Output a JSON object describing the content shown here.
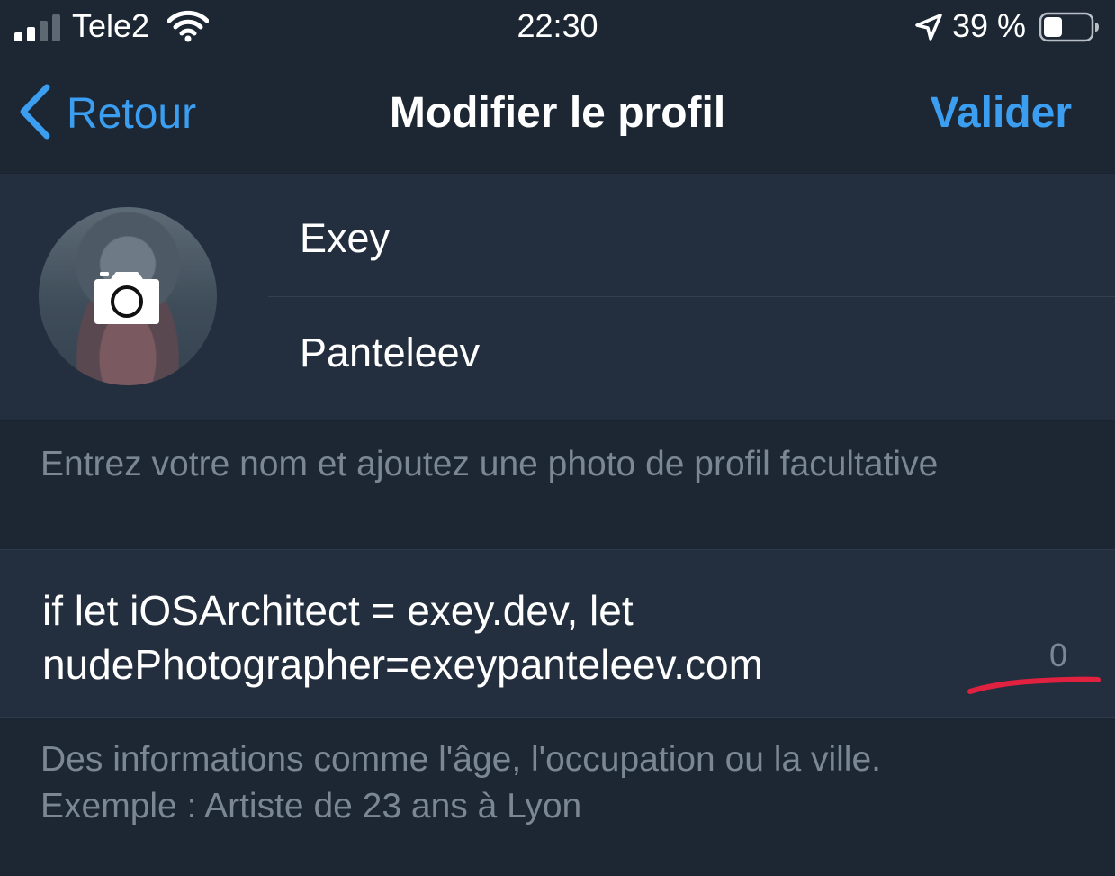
{
  "status_bar": {
    "carrier": "Tele2",
    "time": "22:30",
    "battery": "39 %",
    "battery_level": 0.39,
    "signal_bars_active": 2,
    "signal_bars_total": 4
  },
  "nav": {
    "back_label": "Retour",
    "title": "Modifier le profil",
    "done_label": "Valider"
  },
  "profile": {
    "first_name": "Exey",
    "last_name": "Panteleev",
    "hint": "Entrez votre nom et ajoutez une photo de profil facultative"
  },
  "bio": {
    "line1": "if let iOSArchitect = exey.dev, let",
    "line2": "nudePhotographer=exeypanteleev.com",
    "counter": "0",
    "hint_line1": "Des informations comme l'âge, l'occupation ou la ville.",
    "hint_line2": "Exemple : Artiste de 23 ans à Lyon"
  },
  "colors": {
    "background": "#1c2733",
    "section": "#232f3e",
    "accent": "#3b9ef0",
    "hint_text": "#7b8794",
    "annotation": "#e0213f"
  },
  "icons": [
    "signal-icon",
    "wifi-icon",
    "location-arrow-icon",
    "battery-icon",
    "chevron-left-icon",
    "camera-icon"
  ]
}
